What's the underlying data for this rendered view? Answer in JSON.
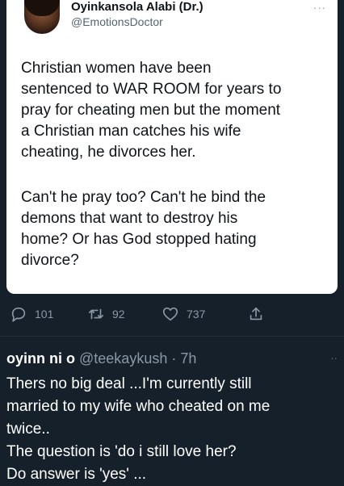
{
  "tweet": {
    "author_name": "Oyinkansola Alabi (Dr.)",
    "author_handle": "@EmotionsDoctor",
    "more_icon": "···",
    "paragraph1": "Christian women have been\nsentenced to WAR ROOM for years to\npray for cheating men but the moment\na Christian man catches his wife\ncheating, he divorces her.",
    "paragraph2": "Can't he pray too? Can't he bind the\ndemons that want to destroy his\nhome? Or has God stopped hating\ndivorce?"
  },
  "actions": {
    "replies": "101",
    "retweets": "92",
    "likes": "737"
  },
  "reply": {
    "author_name": "oyinn ni o",
    "author_handle": "@teekaykush",
    "time": "· 7h",
    "more_icon": "··",
    "text": "Thers no big deal  ...I'm currently still\nmarried to my wife who cheated on me\ntwice..\nThe question is 'do i still love her?\nDo answer is 'yes'  ..."
  },
  "colors": {
    "background": "#15202b",
    "card": "#ffffff",
    "icon": "#8b98a5"
  }
}
